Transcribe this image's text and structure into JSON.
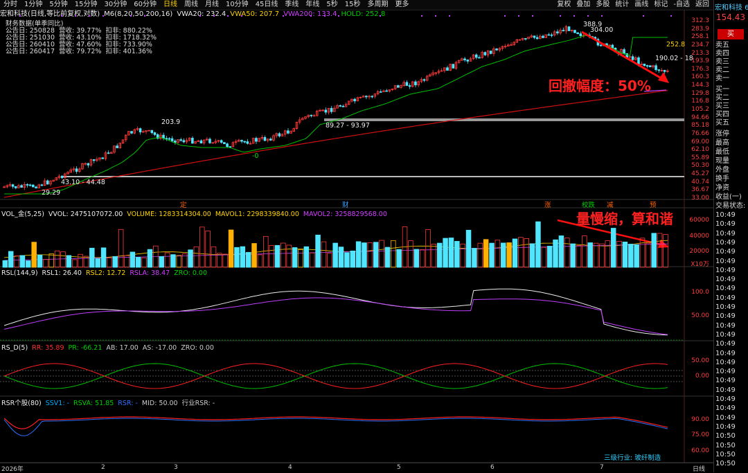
{
  "toolbar": {
    "periods": [
      "分时",
      "1分钟",
      "5分钟",
      "15分钟",
      "30分钟",
      "60分钟",
      "日线",
      "周线",
      "月线",
      "10分钟",
      "45日线",
      "季线",
      "年线",
      "5秒",
      "15秒",
      "多周期",
      "更多"
    ],
    "active_period": "日线",
    "tools": [
      "复权",
      "叠加",
      "多股",
      "统计",
      "画线",
      "标记",
      "-自选",
      "返回"
    ]
  },
  "title": {
    "name": "宏和科技(日线,等比前复权,对数)",
    "ma_label": "M6(8,20,50,200,16)",
    "vwa20": "VWA20: 232.4",
    "vwa50": "VWA50: 207.7",
    "vwa200": "VWA200: 133.4",
    "hold": "HOLD: 252.8"
  },
  "financial": {
    "header": "财务数据(单季同比)",
    "rows": [
      {
        "date": "公告日: 250828",
        "rev": "营收:  39.77%",
        "deduct": "扣非:  880.22%"
      },
      {
        "date": "公告日: 251030",
        "rev": "营收:  43.10%",
        "deduct": "扣非: 1718.32%"
      },
      {
        "date": "公告日: 260410",
        "rev": "营收:  47.60%",
        "deduct": "扣非:  733.90%"
      },
      {
        "date": "公告日: 260417",
        "rev": "营收:  79.72%",
        "deduct": "扣非:  401.36%"
      }
    ]
  },
  "price_axis": [
    "312.3",
    "283.9",
    "258.1",
    "234.7",
    "213.3",
    "193.9",
    "176.3",
    "160.3",
    "144.3",
    "129.8",
    "116.8",
    "105.2",
    "94.66",
    "85.18",
    "76.66",
    "69.00",
    "62.10",
    "55.89",
    "50.30",
    "45.27",
    "40.74",
    "36.67",
    "33.00"
  ],
  "annotations": {
    "high": "388.9",
    "p304": "304.00",
    "p252": "252.8",
    "p190": "190.02 - 18",
    "p203": "203.9",
    "range1": "89.27 - 93.97",
    "range2": "43.10 - 44.48",
    "low": "29.29",
    "drawdown": "回撤幅度：50%",
    "volnote": "量慢缩，算和谐",
    "green_marker": "-0"
  },
  "event_markers": [
    "定",
    "财",
    "涨",
    "校跌",
    "减",
    "预"
  ],
  "vol": {
    "head": "VOL_金(5,25)",
    "vvol": "VVOL: 2475107072.00",
    "volume": "VOLUME: 1283314304.00",
    "mavol1": "MAVOL1: 2298339840.00",
    "mavol2": "MAVOL2: 3258829568.00",
    "axis": [
      "60000",
      "40000",
      "20000",
      "X10万"
    ]
  },
  "rsl": {
    "head": "RSL(144,9)",
    "rsl1": "RSL1: 26.40",
    "rsl2": "RSL2: 12.72",
    "rsla": "RSLA: 38.47",
    "zro": "ZRO: 0.00",
    "axis": [
      "100.0",
      "50.00"
    ]
  },
  "rsd": {
    "head": "RS_D(5)",
    "rr": "RR: 35.89",
    "pr": "PR: -66.21",
    "ab": "AB: 17.00",
    "as": "AS: -17.00",
    "zro": "ZRO: 0.00",
    "axis": [
      "50.00",
      "0.00"
    ]
  },
  "rsr": {
    "head": "RSR个股(80)",
    "ssv1": "SSV1: -",
    "rsva": "RSVA: 51.85",
    "rsr": "RSR: -",
    "mid": "MID: 50.00",
    "industry": "行业RSR: -",
    "axis": [
      "90.00",
      "75.00",
      "60.00"
    ],
    "sector": "三级行业: 玻纤制造"
  },
  "x_axis": [
    "2026年",
    "2",
    "3",
    "4",
    "5",
    "6",
    "7",
    "日线"
  ],
  "right_panel": {
    "name": "宏和科技 6",
    "price": "154.43",
    "buy": "买",
    "sells": [
      "卖五",
      "卖四",
      "卖三",
      "卖二",
      "卖一"
    ],
    "buys": [
      "买一",
      "买二",
      "买三",
      "买四",
      "买五"
    ],
    "stats": [
      "涨停",
      "最高",
      "最低",
      "现量",
      "外盘",
      "换手",
      "净资",
      "收益(一)",
      "交易状态:"
    ],
    "times": [
      "10:49",
      "10:49",
      "10:49",
      "10:49",
      "10:49",
      "10:49",
      "10:49",
      "10:49",
      "10:49",
      "10:49",
      "10:49",
      "10:49",
      "10:49",
      "10:49",
      "10:49",
      "10:49",
      "10:49",
      "10:49",
      "10:49",
      "10:49",
      "10:49",
      "10:49",
      "10:49",
      "10:49",
      "10:50",
      "10:50",
      "10:50",
      "10:50",
      "10:50",
      "10:50",
      "10:50",
      "10:50",
      "10:50",
      "10:50"
    ]
  },
  "colors": {
    "up": "#ff3b3b",
    "down": "#50e6ff",
    "ma200": "#d01010",
    "hold": "#00c000",
    "vol_orange": "#ffb000"
  }
}
